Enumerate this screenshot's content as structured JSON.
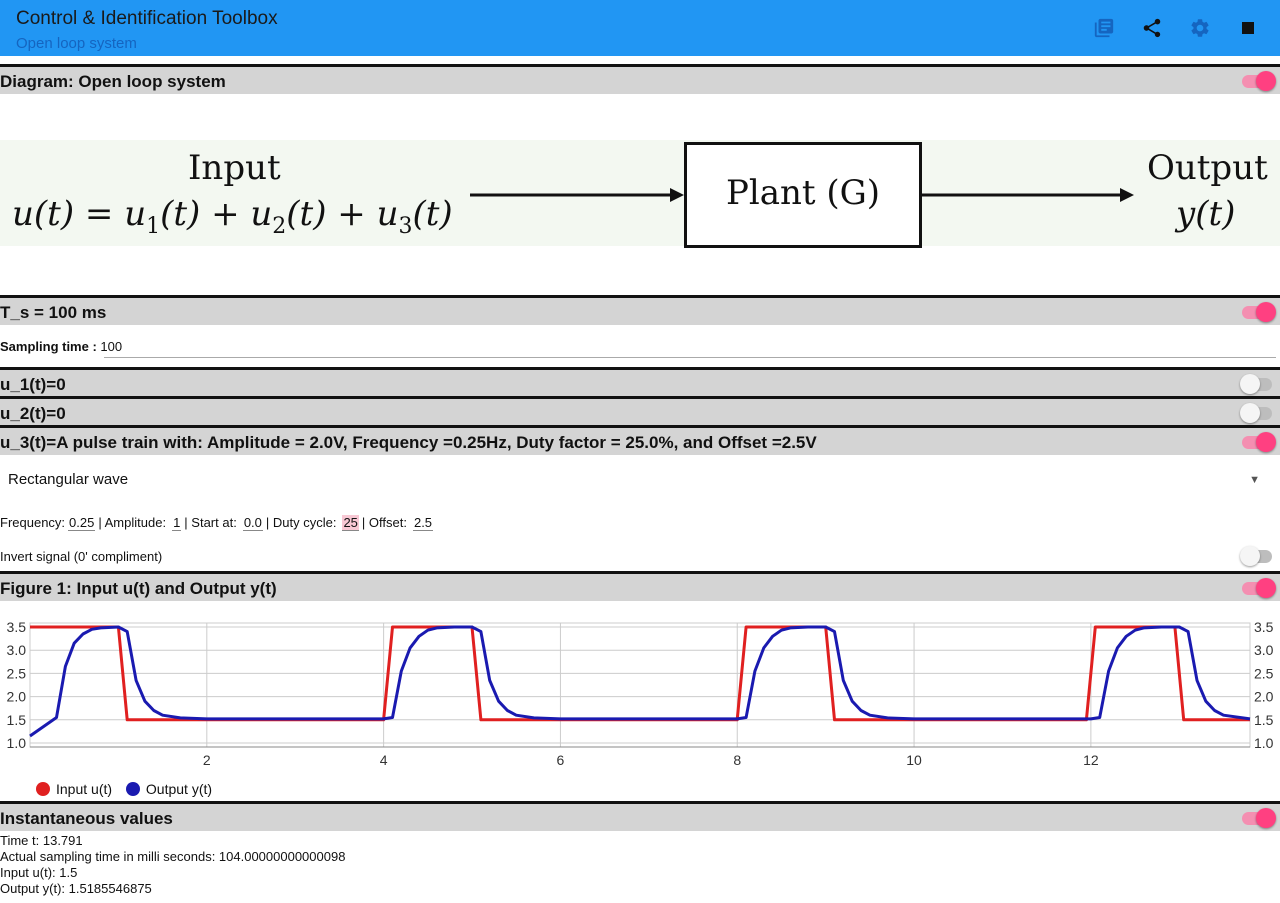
{
  "app": {
    "title": "Control & Identification Toolbox",
    "subtitle": "Open loop system",
    "icons": [
      "library-icon",
      "share-icon",
      "settings-icon",
      "stop-icon"
    ]
  },
  "diagram_section": {
    "header": "Diagram: Open loop system",
    "toggle": true,
    "input_label": "Input",
    "input_formula_lhs": "u(t) = u",
    "output_label": "Output",
    "output_var": "y(t)",
    "plant_label": "Plant (G)"
  },
  "sampling_section": {
    "header": "T_s = 100 ms",
    "toggle": true,
    "field_label": "Sampling time :",
    "field_value": "100"
  },
  "u1_section": {
    "header": "u_1(t)=0",
    "toggle": false
  },
  "u2_section": {
    "header": "u_2(t)=0",
    "toggle": false
  },
  "u3_section": {
    "header": "u_3(t)=A pulse train with: Amplitude = 2.0V, Frequency =0.25Hz, Duty factor = 25.0%, and Offset =2.5V",
    "toggle": true,
    "waveform": "Rectangular wave",
    "frequency_label": "Frequency:",
    "frequency_value": "0.25",
    "amplitude_label": "| Amplitude:",
    "amplitude_value": "1",
    "start_label": "| Start at:",
    "start_value": "0.0",
    "duty_label": "| Duty cycle:",
    "duty_value": "25",
    "offset_label": "| Offset:",
    "offset_value": "2.5",
    "invert_label": "Invert signal (0' compliment)",
    "invert_toggle": false
  },
  "figure_section": {
    "header": "Figure 1: Input u(t) and Output y(t)",
    "toggle": true
  },
  "instant_section": {
    "header": "Instantaneous values",
    "toggle": true,
    "time": "Time t: 13.791",
    "actual_sampling": "Actual sampling time in milli seconds: 104.00000000000098",
    "input": "Input u(t): 1.5",
    "output": "Output y(t): 1.5185546875"
  },
  "colors": {
    "appbar": "#2196f3",
    "input_series": "#e02020",
    "output_series": "#1a1ab0"
  },
  "chart_data": {
    "type": "line",
    "xlim": [
      0,
      13.8
    ],
    "ylim": [
      1.0,
      3.5
    ],
    "xticks": [
      "2",
      "4",
      "6",
      "8",
      "10",
      "12"
    ],
    "yticks": [
      "1.0",
      "1.5",
      "2.0",
      "2.5",
      "3.0",
      "3.5"
    ],
    "grid": true,
    "legend_position": "bottom-left",
    "series": [
      {
        "name": "Input u(t)",
        "color": "#e02020",
        "x": [
          0,
          1.0,
          1.1,
          4.0,
          4.1,
          5.0,
          5.1,
          8.0,
          8.1,
          9.0,
          9.1,
          11.95,
          12.05,
          12.95,
          13.05,
          13.8
        ],
        "y": [
          3.5,
          3.5,
          1.5,
          1.5,
          3.5,
          3.5,
          1.5,
          1.5,
          3.5,
          3.5,
          1.5,
          1.5,
          3.5,
          3.5,
          1.5,
          1.5
        ]
      },
      {
        "name": "Output y(t)",
        "color": "#1a1ab0",
        "x": [
          0,
          0.3,
          0.4,
          0.5,
          0.6,
          0.7,
          0.8,
          1.0,
          1.1,
          1.2,
          1.3,
          1.4,
          1.5,
          1.7,
          2.0,
          4.0,
          4.1,
          4.2,
          4.3,
          4.4,
          4.5,
          4.6,
          4.8,
          5.0,
          5.1,
          5.2,
          5.3,
          5.4,
          5.5,
          5.7,
          6.0,
          8.0,
          8.1,
          8.2,
          8.3,
          8.4,
          8.5,
          8.6,
          8.8,
          9.0,
          9.1,
          9.2,
          9.3,
          9.4,
          9.5,
          9.7,
          10.0,
          12.0,
          12.1,
          12.2,
          12.3,
          12.4,
          12.5,
          12.6,
          12.8,
          13.0,
          13.1,
          13.2,
          13.3,
          13.4,
          13.5,
          13.8
        ],
        "y": [
          1.15,
          1.55,
          2.65,
          3.15,
          3.35,
          3.45,
          3.48,
          3.5,
          3.4,
          2.35,
          1.9,
          1.7,
          1.6,
          1.54,
          1.52,
          1.52,
          1.55,
          2.55,
          3.05,
          3.3,
          3.43,
          3.48,
          3.5,
          3.5,
          3.4,
          2.35,
          1.9,
          1.7,
          1.6,
          1.54,
          1.52,
          1.52,
          1.55,
          2.55,
          3.05,
          3.3,
          3.43,
          3.48,
          3.5,
          3.5,
          3.4,
          2.35,
          1.9,
          1.7,
          1.6,
          1.54,
          1.52,
          1.52,
          1.55,
          2.55,
          3.05,
          3.3,
          3.43,
          3.48,
          3.5,
          3.5,
          3.4,
          2.35,
          1.9,
          1.7,
          1.6,
          1.52
        ]
      }
    ]
  }
}
